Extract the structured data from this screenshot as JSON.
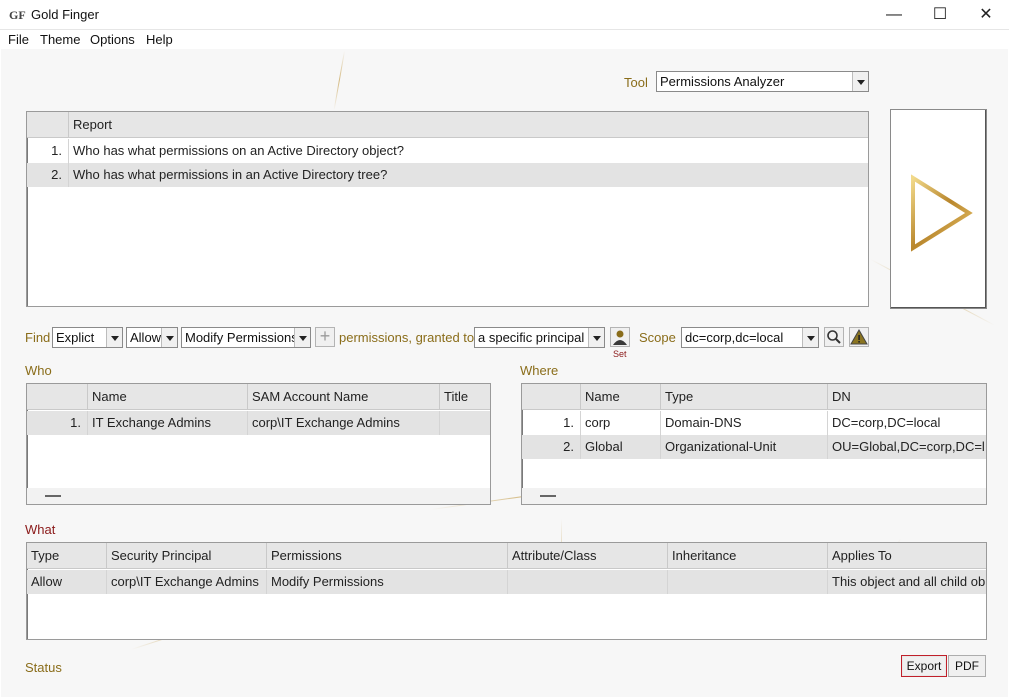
{
  "window": {
    "title": "Gold Finger",
    "logo_text": "GF",
    "controls": [
      "—",
      "☐",
      "✕"
    ]
  },
  "menu": [
    "File",
    "Theme",
    "Options",
    "Help"
  ],
  "tool": {
    "label": "Tool",
    "value": "Permissions Analyzer"
  },
  "reports": {
    "header": "Report",
    "rows": [
      {
        "n": "1.",
        "text": "Who has what permissions on an Active Directory object?"
      },
      {
        "n": "2.",
        "text": "Who has what permissions in an Active Directory tree?"
      }
    ],
    "selected_index": 1
  },
  "find": {
    "label": "Find",
    "type": "Explict",
    "access": "Allow",
    "permission": "Modify Permissions",
    "add_symbol": "+",
    "granted_text": "permissions, granted to",
    "principal": "a specific principal",
    "set_label": "Set",
    "scope_label": "Scope",
    "scope_value": "dc=corp,dc=local"
  },
  "who": {
    "label": "Who",
    "headers": [
      "Name",
      "SAM Account Name",
      "Title"
    ],
    "rows": [
      {
        "n": "1.",
        "name": "IT Exchange Admins",
        "sam": "corp\\IT Exchange Admins",
        "title": ""
      }
    ]
  },
  "where": {
    "label": "Where",
    "headers": [
      "Name",
      "Type",
      "DN"
    ],
    "rows": [
      {
        "n": "1.",
        "name": "corp",
        "type": "Domain-DNS",
        "dn": "DC=corp,DC=local"
      },
      {
        "n": "2.",
        "name": "Global",
        "type": "Organizational-Unit",
        "dn": "OU=Global,DC=corp,DC=l"
      }
    ]
  },
  "what": {
    "label": "What",
    "headers": [
      "Type",
      "Security Principal",
      "Permissions",
      "Attribute/Class",
      "Inheritance",
      "Applies To"
    ],
    "rows": [
      {
        "type": "Allow",
        "principal": "corp\\IT Exchange Admins",
        "permissions": "Modify Permissions",
        "attribute": "",
        "inheritance": "",
        "applies": "This object and all child ob"
      }
    ]
  },
  "status": {
    "label": "Status"
  },
  "buttons": {
    "export": "Export",
    "pdf": "PDF"
  },
  "colors": {
    "accent_gold": "#8a6d1a",
    "what_red": "#8b1a1a",
    "selected_row": "#e3e3e3",
    "export_border": "#c0202a"
  }
}
